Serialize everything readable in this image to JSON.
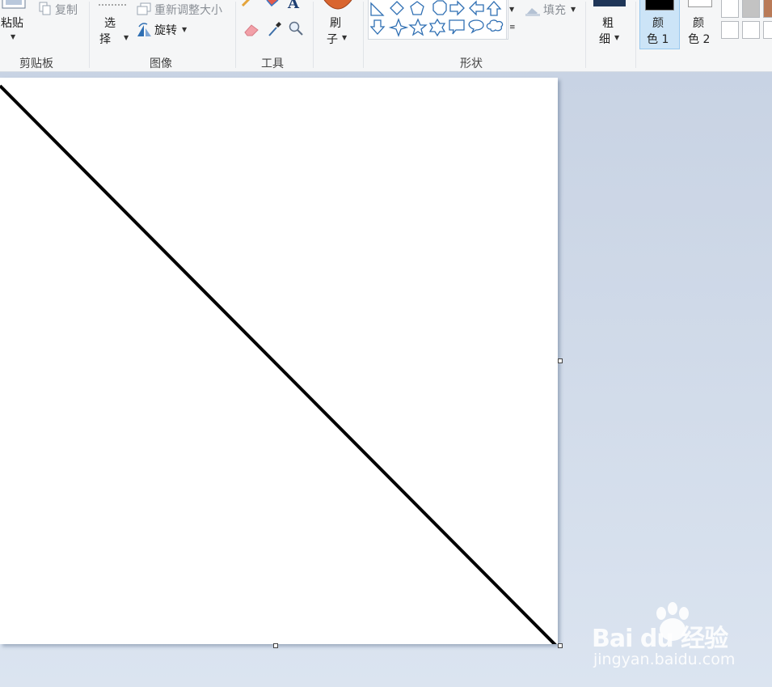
{
  "clipboard": {
    "paste_label": "粘贴",
    "copy_label": "复制",
    "group_label": "剪贴板"
  },
  "image": {
    "select_label_1": "选",
    "select_label_2": "择",
    "resize_label": "重新调整大小",
    "rotate_label": "旋转",
    "group_label": "图像"
  },
  "tools": {
    "group_label": "工具",
    "pencil_icon": "pencil-icon",
    "fill_icon": "fill-bucket-icon",
    "text_icon": "A",
    "eraser_icon": "eraser-icon",
    "picker_icon": "color-picker-icon",
    "magnifier_icon": "magnifier-icon"
  },
  "brush": {
    "label_1": "刷",
    "label_2": "子"
  },
  "shapes": {
    "group_label": "形状",
    "fill_label": "填充"
  },
  "size": {
    "label_1": "粗",
    "label_2": "细"
  },
  "colors": {
    "color1_label_1": "颜",
    "color1_label_2": "色 1",
    "color2_label_1": "颜",
    "color2_label_2": "色 2",
    "color1": "#000000",
    "color2": "#ffffff",
    "palette": [
      "#ffffff",
      "#c3c3c3",
      "#b97a57",
      "#ffffff",
      "#ffffff",
      "#ffffff"
    ]
  },
  "watermark": {
    "brand": "Bai du 经验",
    "url": "jingyan.baidu.com"
  }
}
